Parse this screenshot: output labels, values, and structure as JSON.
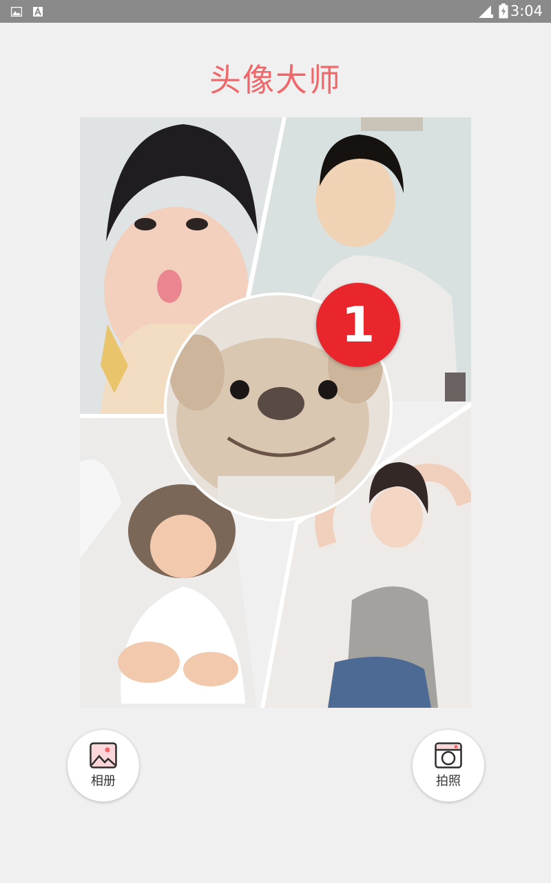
{
  "status_bar": {
    "time": "3:04",
    "icons": [
      "image-icon",
      "font-icon",
      "signal-icon",
      "battery-icon"
    ]
  },
  "app": {
    "title": "头像大师"
  },
  "collage": {
    "badge_number": "1",
    "photos": [
      "girl-photo",
      "boy-photo",
      "dog-photo",
      "baby-photo",
      "woman-photo"
    ]
  },
  "actions": {
    "album_label": "相册",
    "camera_label": "拍照"
  },
  "colors": {
    "accent": "#f0676a",
    "badge": "#e8262b",
    "status_bar": "#8a8a8a",
    "background": "#f0f0f0"
  }
}
